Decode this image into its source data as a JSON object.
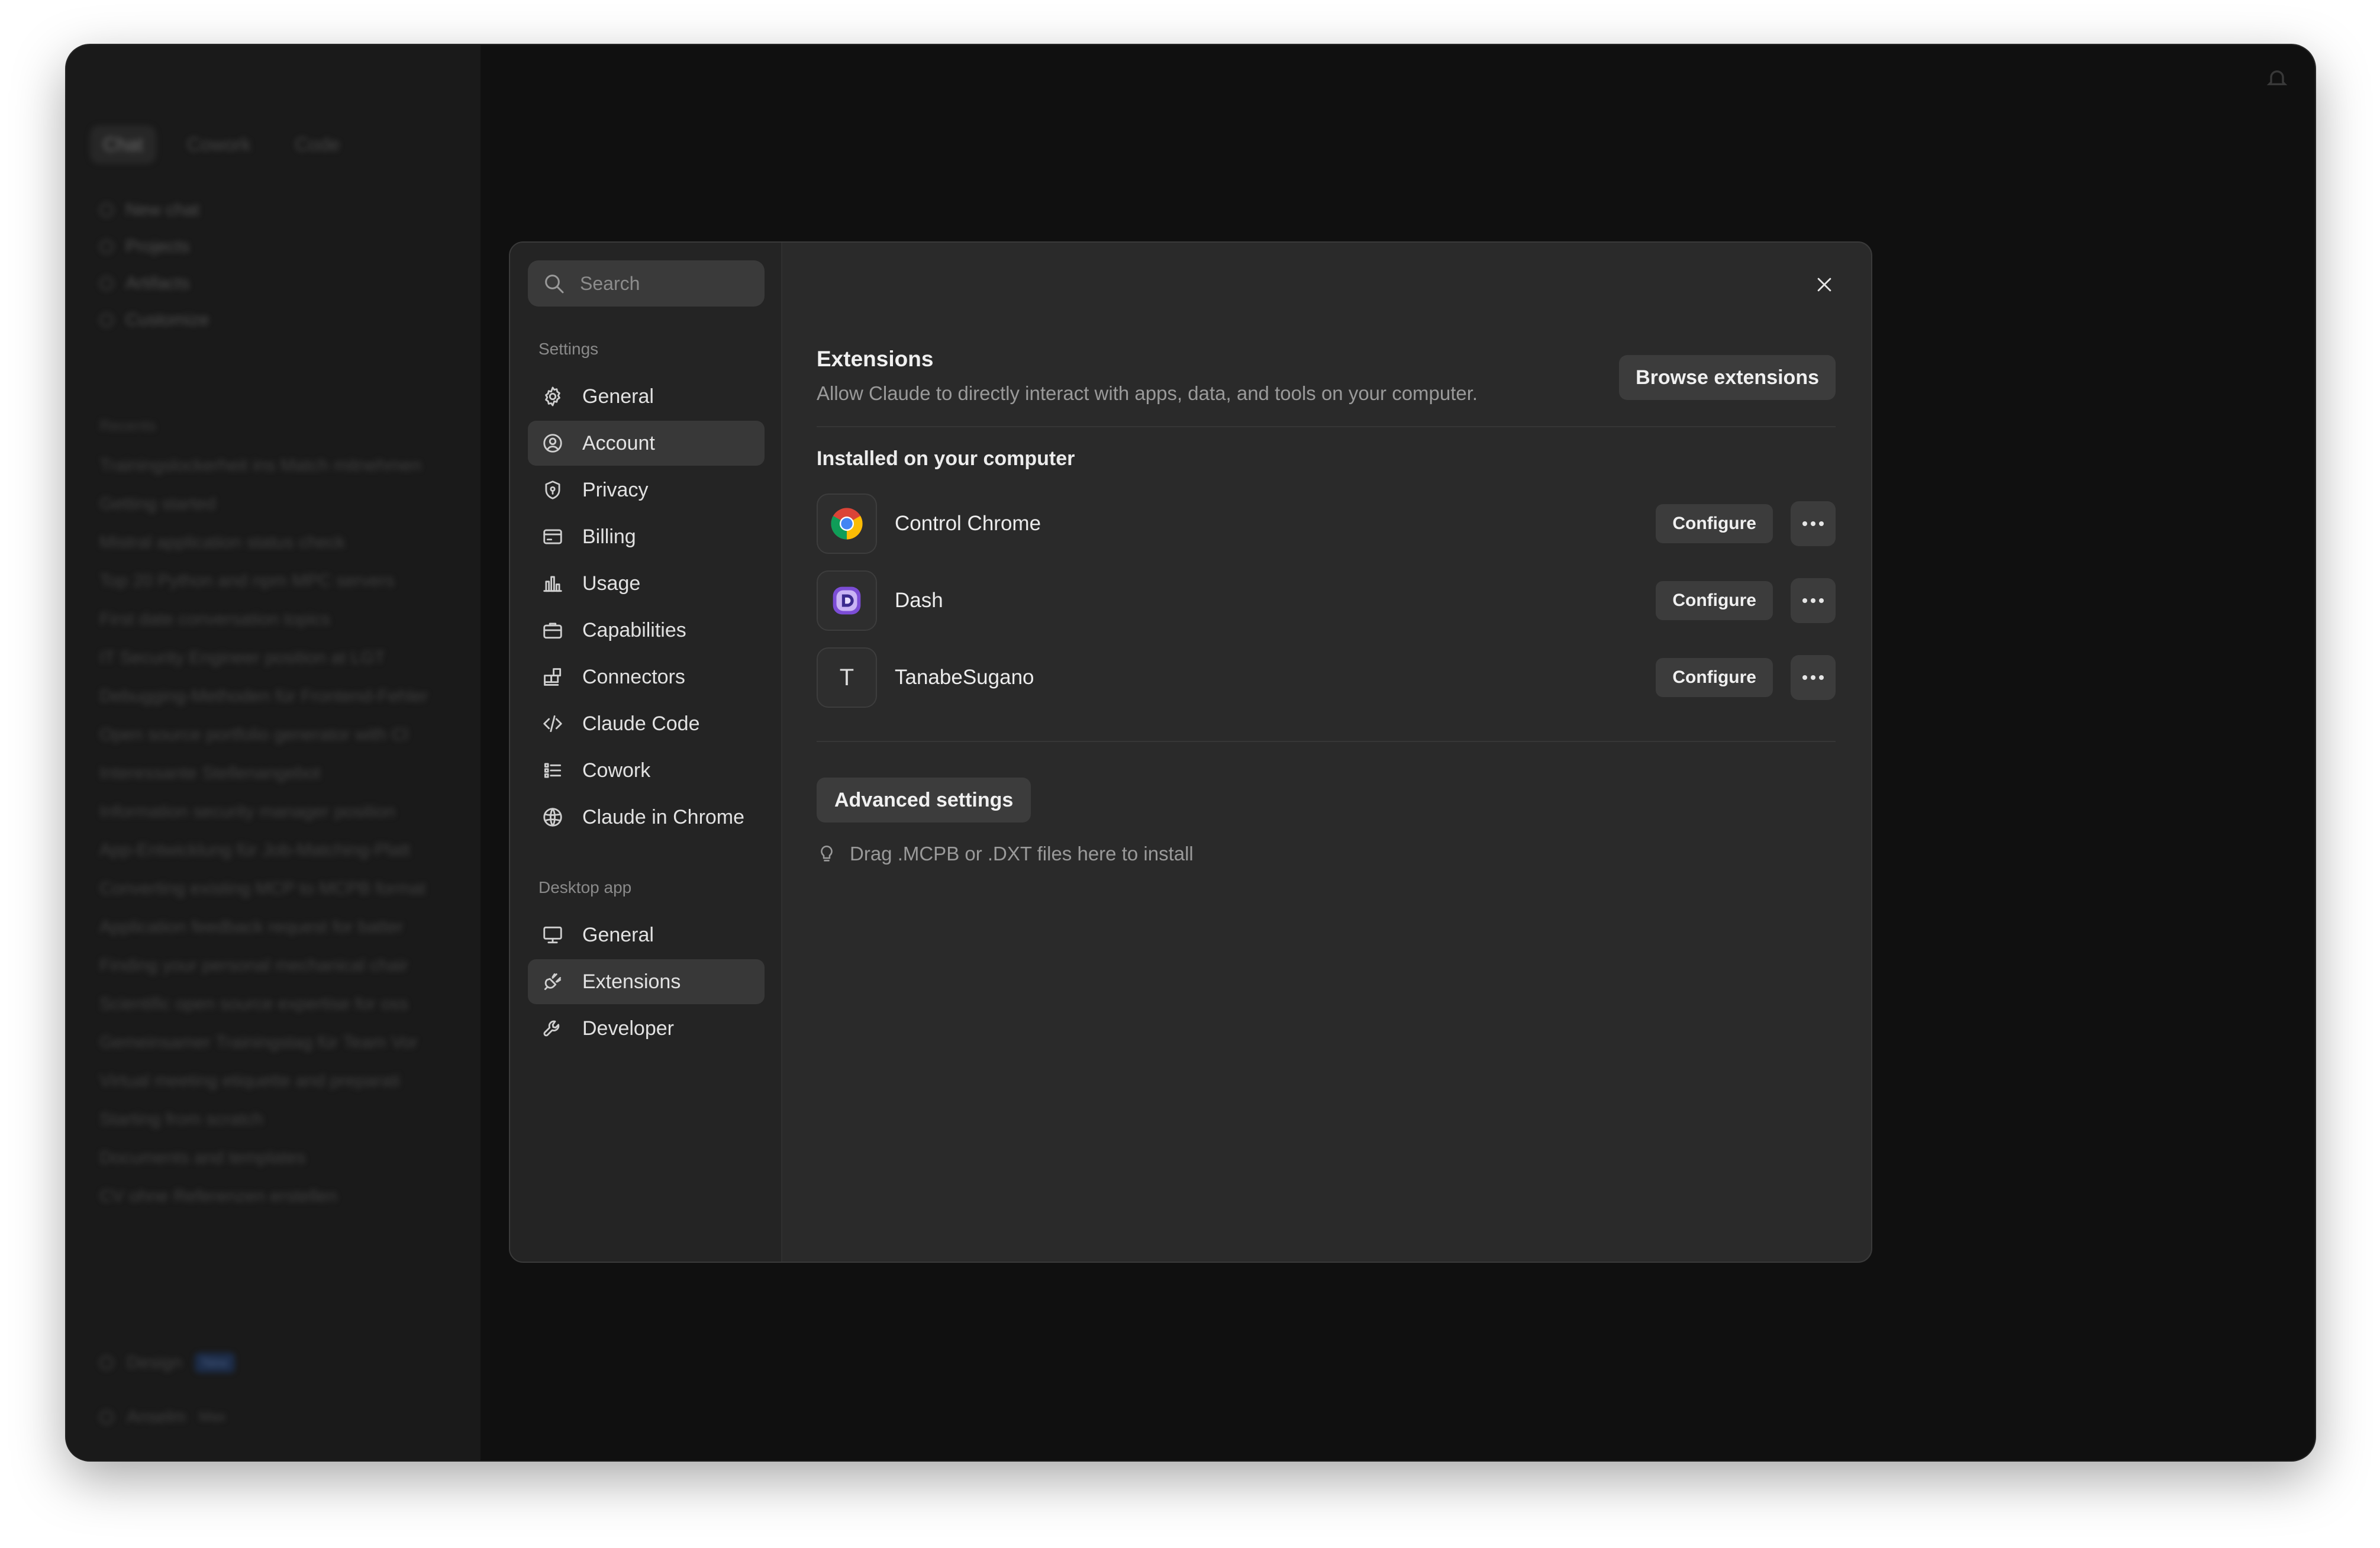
{
  "app_sidebar": {
    "mode_tabs": [
      "Chat",
      "Cowork",
      "Code"
    ],
    "nav": [
      "New chat",
      "Projects",
      "Artifacts",
      "Customize"
    ],
    "recents_label": "Recents",
    "recents": [
      "Trainingslockerheit ins Match mitnehmen",
      "Getting started",
      "Mistral application status check",
      "Top 20 Python and npm MPC servers",
      "First date conversation topics",
      "IT Security Engineer position at LGT",
      "Debugging-Methoden für Frontend-Fehler",
      "Open source portfolio generator with Cl",
      "Interessante Stellenangebot",
      "Information security manager position",
      "App-Entwicklung für Job-Matching-Platt",
      "Converting existing MCP to MCPB format",
      "Application feedback request for batter",
      "Finding your personal mechanical chair",
      "Scientific open source expertise for oss",
      "Gemeinsamer Trainingstag für Team Vor",
      "Virtual meeting etiquette and preparati",
      "Starting from scratch",
      "Documents and templates",
      "CV ohne Referenzen erstellen"
    ],
    "design_label": "Design",
    "design_badge": "New",
    "user_name": "Anselm",
    "user_plan": "Max"
  },
  "settings": {
    "search_placeholder": "Search",
    "section_settings": "Settings",
    "settings_items": [
      {
        "label": "General",
        "icon": "gear-icon"
      },
      {
        "label": "Account",
        "icon": "user-circle-icon"
      },
      {
        "label": "Privacy",
        "icon": "shield-icon"
      },
      {
        "label": "Billing",
        "icon": "credit-card-icon"
      },
      {
        "label": "Usage",
        "icon": "bar-chart-icon"
      },
      {
        "label": "Capabilities",
        "icon": "briefcase-icon"
      },
      {
        "label": "Connectors",
        "icon": "blocks-icon"
      },
      {
        "label": "Claude Code",
        "icon": "code-icon"
      },
      {
        "label": "Cowork",
        "icon": "checklist-icon"
      },
      {
        "label": "Claude in Chrome",
        "icon": "globe-icon"
      }
    ],
    "section_desktop": "Desktop app",
    "desktop_items": [
      {
        "label": "General",
        "icon": "monitor-icon"
      },
      {
        "label": "Extensions",
        "icon": "plug-icon"
      },
      {
        "label": "Developer",
        "icon": "wrench-icon"
      }
    ],
    "active_item": "Extensions"
  },
  "extensions": {
    "title": "Extensions",
    "description": "Allow Claude to directly interact with apps, data, and tools on your computer.",
    "browse_label": "Browse extensions",
    "installed_title": "Installed on your computer",
    "items": [
      {
        "name": "Control Chrome",
        "icon": "chrome-icon",
        "configure_label": "Configure"
      },
      {
        "name": "Dash",
        "icon": "dash-icon",
        "configure_label": "Configure"
      },
      {
        "name": "TanabeSugano",
        "icon": "letter-t-icon",
        "icon_text": "T",
        "configure_label": "Configure"
      }
    ],
    "advanced_label": "Advanced settings",
    "drag_hint": "Drag .MCPB or .DXT files here to install"
  },
  "colors": {
    "modal_bg": "#2a2a2a",
    "button_bg": "#3c3c3c",
    "active_item_bg": "#383838",
    "window_bg": "#101010"
  }
}
